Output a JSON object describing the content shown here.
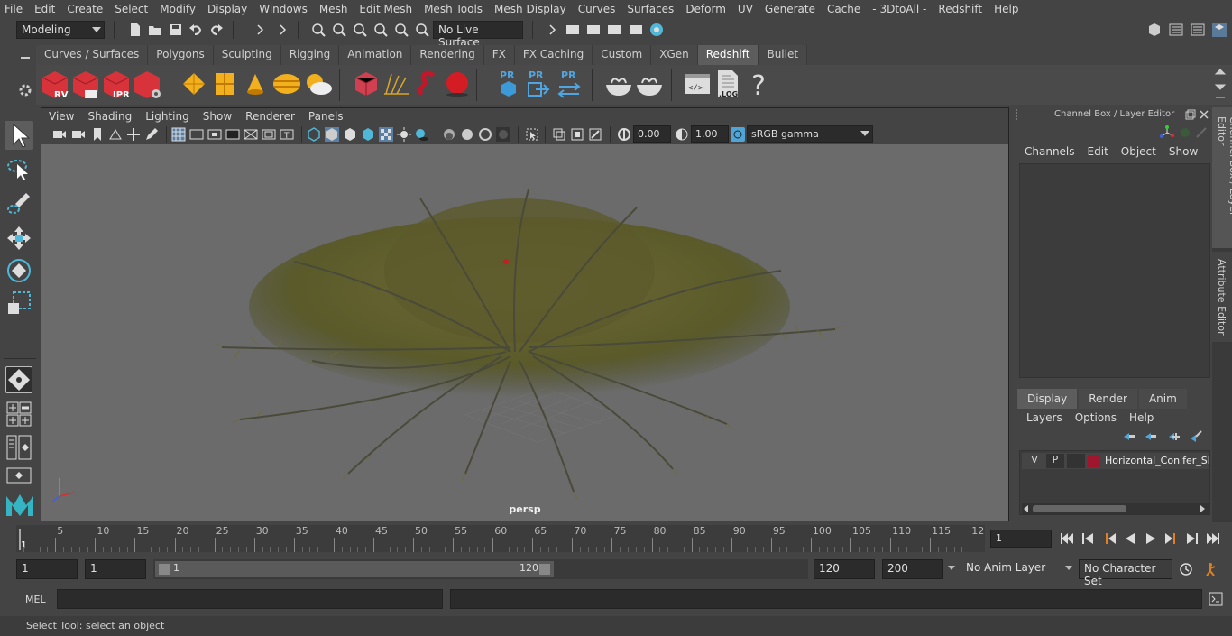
{
  "menubar": [
    "File",
    "Edit",
    "Create",
    "Select",
    "Modify",
    "Display",
    "Windows",
    "Mesh",
    "Edit Mesh",
    "Mesh Tools",
    "Mesh Display",
    "Curves",
    "Surfaces",
    "Deform",
    "UV",
    "Generate",
    "Cache",
    "- 3DtoAll -",
    "Redshift",
    "Help"
  ],
  "status": {
    "mode": "Modeling",
    "live_surface": "No Live Surface"
  },
  "shelf_tabs": [
    "Curves / Surfaces",
    "Polygons",
    "Sculpting",
    "Rigging",
    "Animation",
    "Rendering",
    "FX",
    "FX Caching",
    "Custom",
    "XGen",
    "Redshift",
    "Bullet"
  ],
  "shelf_active": "Redshift",
  "shelf_icons": {
    "rv": "RV",
    "ipr": "IPR",
    "pr1": "PR",
    "pr2": "PR",
    "pr3": "PR",
    "log": ".LOG",
    "help": "?"
  },
  "viewport": {
    "menu": [
      "View",
      "Shading",
      "Lighting",
      "Show",
      "Renderer",
      "Panels"
    ],
    "exposure": "0.00",
    "gamma": "1.00",
    "colorspace": "sRGB gamma",
    "camera": "persp"
  },
  "channelbox": {
    "title": "Channel Box / Layer Editor",
    "menu": [
      "Channels",
      "Edit",
      "Object",
      "Show"
    ]
  },
  "layer_editor": {
    "tabs": [
      "Display",
      "Render",
      "Anim"
    ],
    "active_tab": "Display",
    "menu": [
      "Layers",
      "Options",
      "Help"
    ],
    "layers": [
      {
        "v": "V",
        "p": "P",
        "color": "#a0162e",
        "name": "Horizontal_Conifer_Sh"
      }
    ]
  },
  "side_tabs": [
    "Channel Box / Layer Editor",
    "Attribute Editor"
  ],
  "timeline": {
    "ticks": [
      "5",
      "10",
      "15",
      "20",
      "25",
      "30",
      "35",
      "40",
      "45",
      "50",
      "55",
      "60",
      "65",
      "70",
      "75",
      "80",
      "85",
      "90",
      "95",
      "100",
      "105",
      "110",
      "115",
      "12"
    ],
    "start_mark": "1",
    "current_frame": "1"
  },
  "range": {
    "start": "1",
    "playback_start": "1",
    "slider_start": "1",
    "slider_end": "120",
    "playback_end": "120",
    "end": "200",
    "anim_layer": "No Anim Layer",
    "character_set": "No Character Set"
  },
  "cmd": {
    "label": "MEL"
  },
  "help_text": "Select Tool: select an object"
}
